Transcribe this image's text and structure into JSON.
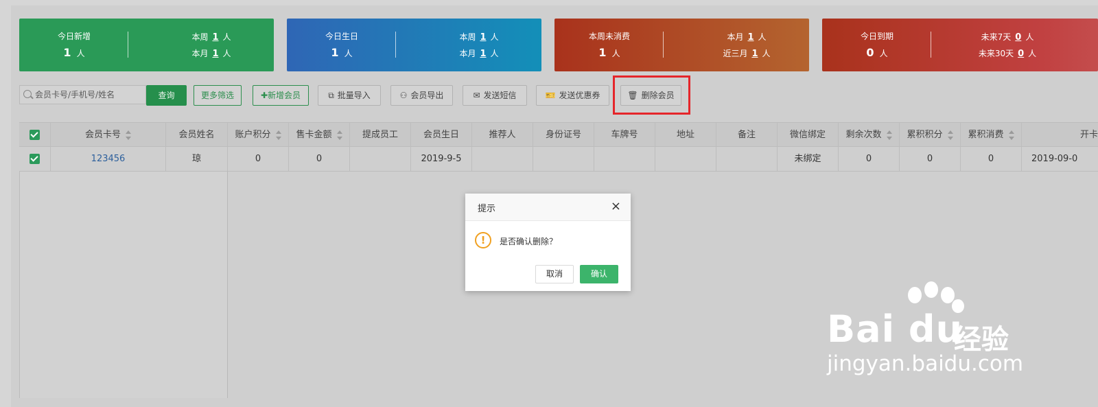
{
  "cards": [
    {
      "left_label": "今日新增",
      "left_value": "1",
      "unit": "人",
      "r1_label": "本周",
      "r1_value": "1",
      "r2_label": "本月",
      "r2_value": "1"
    },
    {
      "left_label": "今日生日",
      "left_value": "1",
      "unit": "人",
      "r1_label": "本周",
      "r1_value": "1",
      "r2_label": "本月",
      "r2_value": "1"
    },
    {
      "left_label": "本周未消费",
      "left_value": "1",
      "unit": "人",
      "r1_label": "本月",
      "r1_value": "1",
      "r2_label": "近三月",
      "r2_value": "1"
    },
    {
      "left_label": "今日到期",
      "left_value": "0",
      "unit": "人",
      "r1_label": "未来7天",
      "r1_value": "0",
      "r2_label": "未来30天",
      "r2_value": "0"
    }
  ],
  "toolbar": {
    "search_placeholder": "会员卡号/手机号/姓名",
    "query": "查询",
    "more_filter": "更多筛选",
    "add_member": "✚新增会员",
    "batch_import": "批量导入",
    "export": "会员导出",
    "send_sms": "发送短信",
    "send_coupon": "发送优惠券",
    "delete_member": "删除会员"
  },
  "table": {
    "headers": [
      "会员卡号",
      "会员姓名",
      "账户积分",
      "售卡金额",
      "提成员工",
      "会员生日",
      "推荐人",
      "身份证号",
      "车牌号",
      "地址",
      "备注",
      "微信绑定",
      "剩余次数",
      "累积积分",
      "累积消费",
      "开卡"
    ],
    "row": [
      "123456",
      "琼",
      "0",
      "0",
      "",
      "2019-9-5",
      "",
      "",
      "",
      "",
      "",
      "未绑定",
      "0",
      "0",
      "0",
      "2019-09-0"
    ]
  },
  "modal": {
    "title": "提示",
    "close": "×",
    "message": "是否确认删除？",
    "cancel": "取消",
    "confirm": "确认"
  },
  "watermark": {
    "logo": "Bai du",
    "cn": "经验",
    "url": "jingyan.baidu.com"
  }
}
